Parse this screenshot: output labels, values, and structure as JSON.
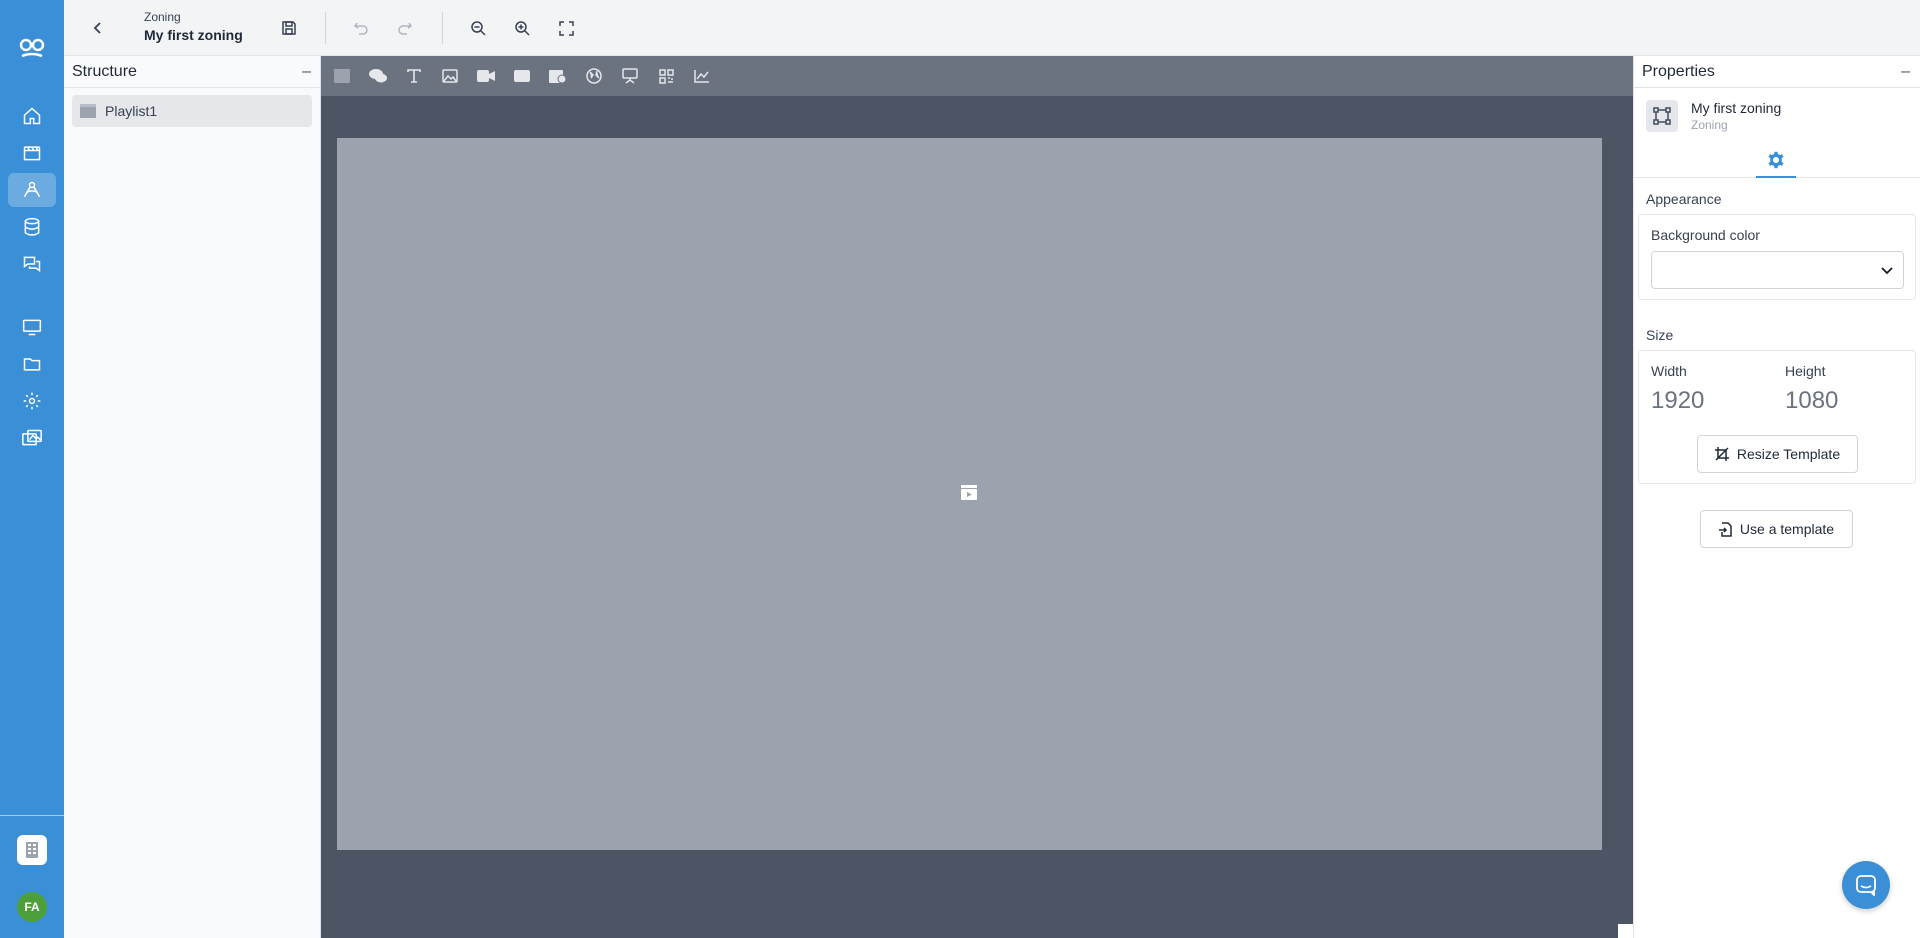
{
  "colors": {
    "rail": "#3b8fd6",
    "accent": "#3b8fd6",
    "avatar": "#4d9f39",
    "canvas_bg": "#4b5563",
    "stage_bg": "#9ca3af"
  },
  "rail": {
    "logo_icon": "app-logo-icon",
    "items": [
      {
        "icon": "home-icon",
        "active": false
      },
      {
        "icon": "playlist-icon",
        "active": false
      },
      {
        "icon": "zoning-icon",
        "active": true
      },
      {
        "icon": "database-icon",
        "active": false
      },
      {
        "icon": "messages-icon",
        "active": false
      },
      {
        "icon": "monitor-icon",
        "active": false
      },
      {
        "icon": "folder-icon",
        "active": false
      },
      {
        "icon": "settings-icon",
        "active": false
      },
      {
        "icon": "media-icon",
        "active": false
      }
    ],
    "tenant_icon": "building-icon",
    "avatar_initials": "FA"
  },
  "topbar": {
    "subtitle": "Zoning",
    "title": "My first zoning"
  },
  "structure": {
    "title": "Structure",
    "minimize": "–",
    "items": [
      {
        "label": "Playlist1",
        "icon": "playlist-icon"
      }
    ]
  },
  "toolbar": {
    "widgets": [
      "playlist-widget-icon",
      "social-widget-icon",
      "text-widget-icon",
      "image-widget-icon",
      "video-widget-icon",
      "shape-widget-icon",
      "schedule-widget-icon",
      "web-widget-icon",
      "presentation-widget-icon",
      "qr-widget-icon",
      "chart-widget-icon"
    ]
  },
  "properties": {
    "title": "Properties",
    "minimize": "–",
    "object_name": "My first zoning",
    "object_type": "Zoning",
    "appearance_label": "Appearance",
    "background_color_label": "Background color",
    "background_color_value": "",
    "size_label": "Size",
    "width_label": "Width",
    "width_value": "1920",
    "height_label": "Height",
    "height_value": "1080",
    "resize_button": "Resize Template",
    "use_template_button": "Use a template"
  }
}
